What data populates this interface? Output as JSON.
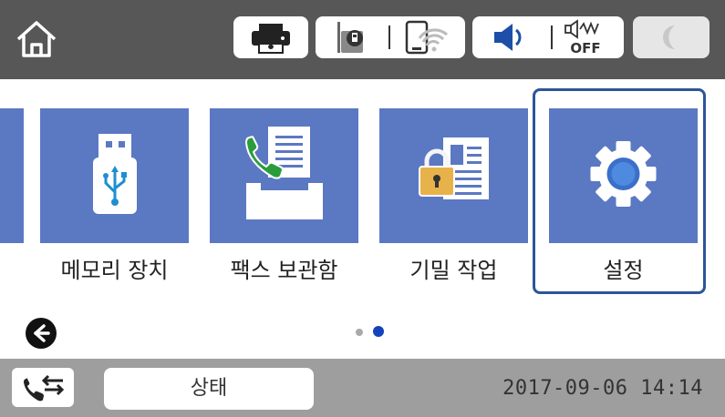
{
  "top_bar": {
    "icons": [
      "home-icon",
      "printer-status-icon",
      "wireless-router-icon",
      "wifi-icon",
      "speaker-icon",
      "quiet-mode-off-icon",
      "sleep-moon-icon"
    ],
    "quiet_label": "OFF"
  },
  "menu": {
    "items": [
      {
        "label": "메모리 장치",
        "icon": "usb-memory-icon"
      },
      {
        "label": "팩스 보관함",
        "icon": "fax-box-icon"
      },
      {
        "label": "기밀 작업",
        "icon": "confidential-job-icon"
      },
      {
        "label": "설정",
        "icon": "gear-icon"
      }
    ],
    "selected_index": 3,
    "page_count": 2,
    "current_page": 2
  },
  "bottom_bar": {
    "status_tab_label": "상태",
    "datetime": "2017-09-06 14:14"
  },
  "colors": {
    "top_bar": "#575757",
    "tile": "#5b78c3",
    "selection": "#2d5599",
    "bottom_bar": "#9e9e9e"
  }
}
